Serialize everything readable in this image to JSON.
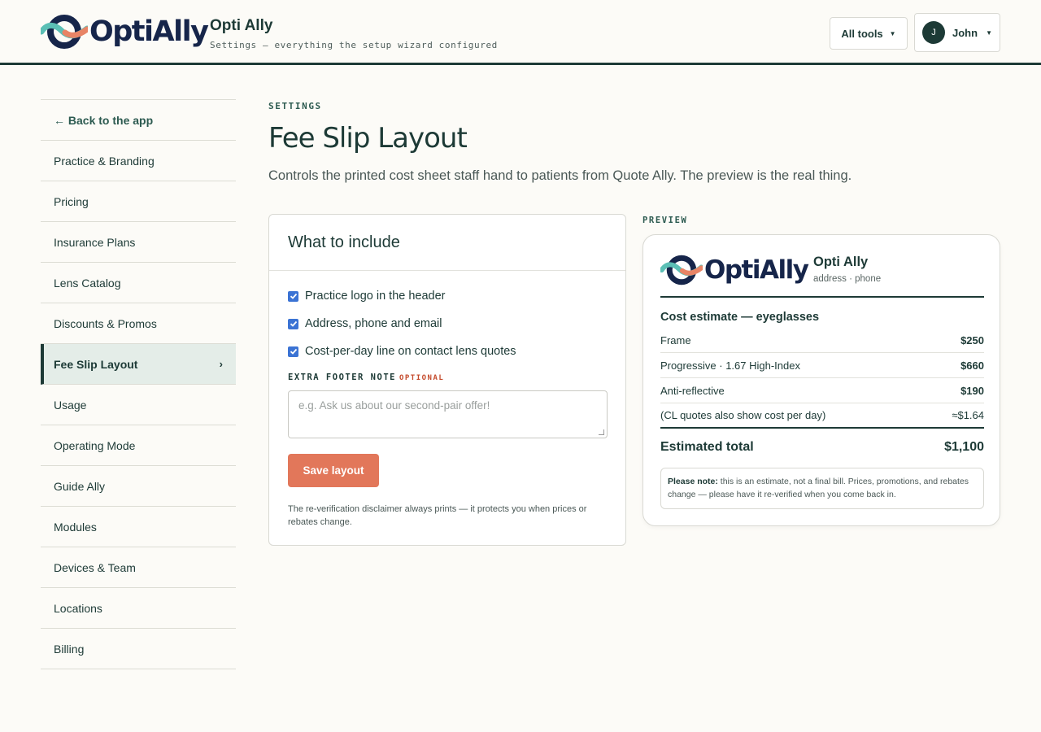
{
  "header": {
    "logo_text": "OptiAlly",
    "app_title": "Opti Ally",
    "subtitle": "Settings — everything the setup wizard configured",
    "tools_label": "All tools",
    "user_initial": "J",
    "user_name": "John"
  },
  "sidebar": {
    "items": [
      {
        "label": "← Back to the app"
      },
      {
        "label": "Practice & Branding"
      },
      {
        "label": "Pricing"
      },
      {
        "label": "Insurance Plans"
      },
      {
        "label": "Lens Catalog"
      },
      {
        "label": "Discounts & Promos"
      },
      {
        "label": "Fee Slip Layout",
        "active": true
      },
      {
        "label": "Usage"
      },
      {
        "label": "Operating Mode"
      },
      {
        "label": "Guide Ally"
      },
      {
        "label": "Modules"
      },
      {
        "label": "Devices & Team"
      },
      {
        "label": "Locations"
      },
      {
        "label": "Billing"
      }
    ],
    "active_chevron": "›"
  },
  "main": {
    "eyebrow": "SETTINGS",
    "title": "Fee Slip Layout",
    "description": "Controls the printed cost sheet staff hand to patients from Quote Ally. The preview is the real thing."
  },
  "form": {
    "heading": "What to include",
    "checkboxes": [
      {
        "label": "Practice logo in the header",
        "checked": true
      },
      {
        "label": "Address, phone and email",
        "checked": true
      },
      {
        "label": "Cost-per-day line on contact lens quotes",
        "checked": true
      }
    ],
    "footer_label": "EXTRA FOOTER NOTE",
    "optional_tag": "OPTIONAL",
    "footer_placeholder": "e.g. Ask us about our second-pair offer!",
    "save_label": "Save layout",
    "note": "The re-verification disclaimer always prints — it protects you when prices or rebates change."
  },
  "preview": {
    "label": "PREVIEW",
    "logo_text": "OptiAlly",
    "practice_name": "Opti Ally",
    "address_line": "address · phone",
    "heading": "Cost estimate — eyeglasses",
    "rows": [
      {
        "label": "Frame",
        "amount": "$250"
      },
      {
        "label": "Progressive · 1.67 High-Index",
        "amount": "$660"
      },
      {
        "label": "Anti-reflective",
        "amount": "$190"
      },
      {
        "label": "(CL quotes also show cost per day)",
        "amount": "≈$1.64"
      }
    ],
    "total_label": "Estimated total",
    "total_amount": "$1,100",
    "note_bold": "Please note:",
    "note_text": " this is an estimate, not a final bill. Prices, promotions, and rebates change — please have it re-verified when you come back in."
  },
  "colors": {
    "primary": "#1d3a36",
    "accent": "#e2775a",
    "checkbox": "#3b73d4",
    "logo_navy": "#16254a",
    "logo_teal": "#5bbfb5",
    "logo_coral": "#e88466"
  }
}
